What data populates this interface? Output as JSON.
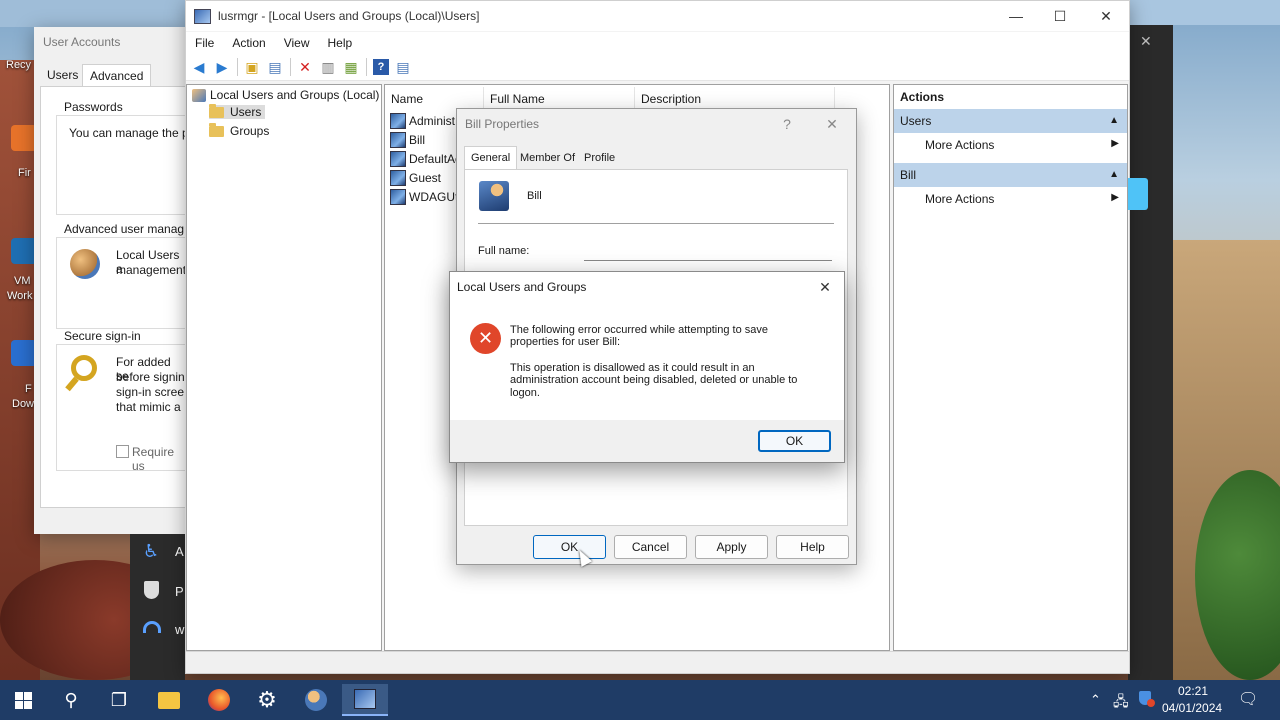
{
  "desktop": {
    "icons": [
      {
        "label": "Recy"
      },
      {
        "label": "Fir"
      },
      {
        "label": "VM"
      },
      {
        "label": "Work"
      },
      {
        "label": "F"
      },
      {
        "label": "Dow"
      }
    ]
  },
  "user_accounts": {
    "title": "User Accounts",
    "tabs": [
      "Users",
      "Advanced"
    ],
    "passwords_heading": "Passwords",
    "passwords_text": "You can manage the p",
    "advanced_heading": "Advanced user manag",
    "advanced_text_1": "Local Users a",
    "advanced_text_2": "management",
    "secure_heading": "Secure sign-in",
    "secure_text_1": "For added se",
    "secure_text_2": "before signin",
    "secure_text_3": "sign-in scree",
    "secure_text_4": "that mimic a",
    "require_label": "Require us"
  },
  "start_menu_fragment": {
    "items": [
      "A",
      "P",
      "w"
    ]
  },
  "mmc": {
    "title": "lusrmgr - [Local Users and Groups (Local)\\Users]",
    "menu": [
      "File",
      "Action",
      "View",
      "Help"
    ],
    "tree_root": "Local Users and Groups (Local)",
    "tree_items": [
      "Users",
      "Groups"
    ],
    "columns": [
      "Name",
      "Full Name",
      "Description"
    ],
    "users": [
      "Administ",
      "Bill",
      "DefaultAc",
      "Guest",
      "WDAGUti"
    ],
    "actions_title": "Actions",
    "actions_sections": [
      {
        "header": "Users",
        "item": "More Actions"
      },
      {
        "header": "Bill",
        "item": "More Actions"
      }
    ]
  },
  "bill_properties": {
    "title": "Bill Properties",
    "help_glyph": "?",
    "tabs": [
      "General",
      "Member Of",
      "Profile"
    ],
    "username": "Bill",
    "full_name_label": "Full name:",
    "full_name_value": "",
    "buttons": [
      "OK",
      "Cancel",
      "Apply",
      "Help"
    ]
  },
  "error_dialog": {
    "title": "Local Users and Groups",
    "line1": "The following error occurred while attempting to save",
    "line2": "properties for user Bill:",
    "line3": "This operation is disallowed as it could result in an",
    "line4": "administration account being disabled, deleted or unable to",
    "line5": "logon.",
    "ok_label": "OK"
  },
  "taskbar": {
    "time": "02:21",
    "date": "04/01/2024"
  },
  "colors": {
    "accent": "#0067c0",
    "error_red": "#e0462a",
    "taskbar": "#1f3c66",
    "actions_section": "#bcd3ea"
  }
}
